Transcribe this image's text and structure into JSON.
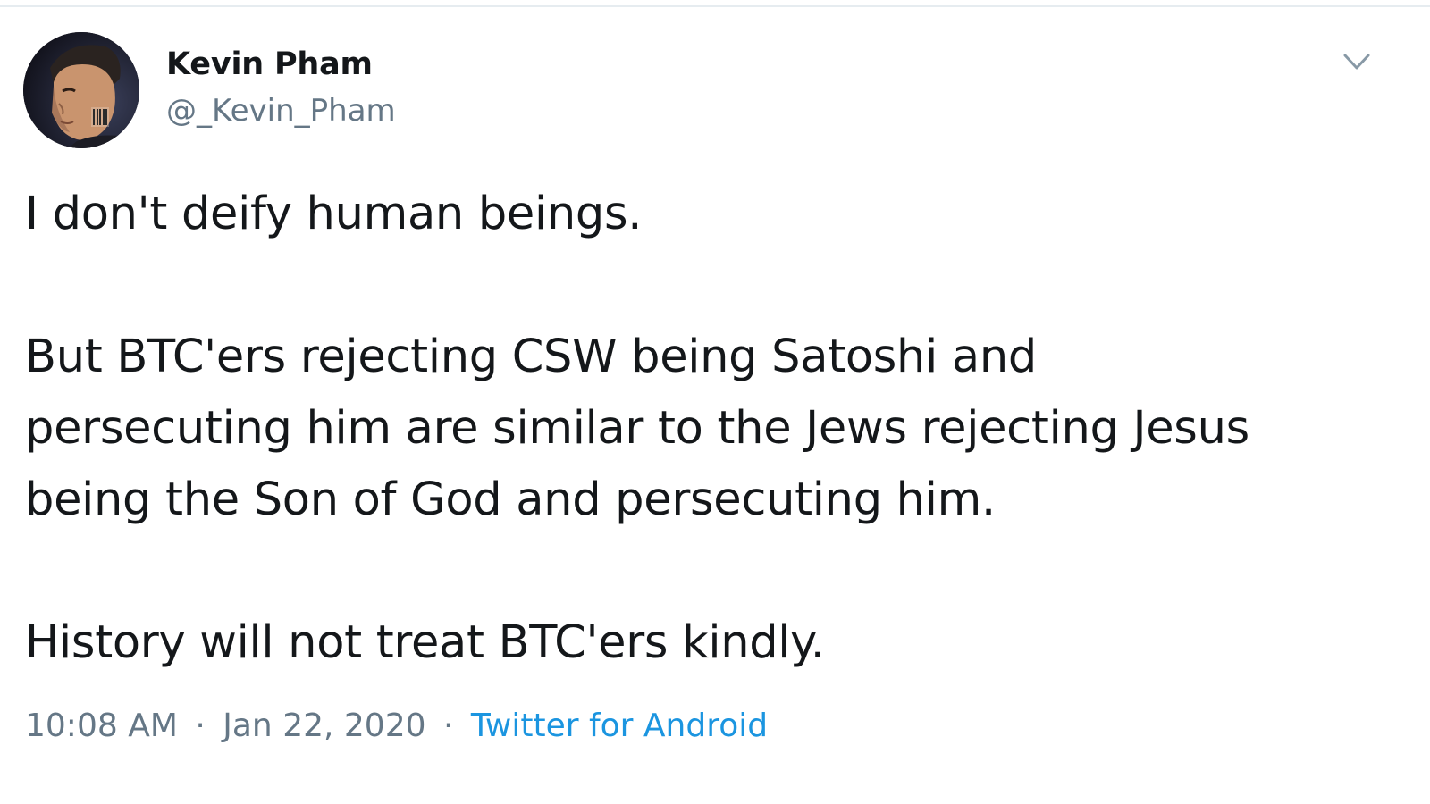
{
  "tweet": {
    "author": {
      "display_name": "Kevin Pham",
      "handle": "@_Kevin_Pham",
      "avatar_icon": "profile-photo"
    },
    "menu_icon": "chevron-down-icon",
    "body": {
      "p1": "I don't deify human beings.",
      "p2_line1": "But BTC'ers rejecting CSW being Satoshi and",
      "p2_line2": "persecuting him are similar to the Jews rejecting Jesus",
      "p2_line3": "being the Son of God and persecuting him.",
      "p3": "History will not treat BTC'ers kindly."
    },
    "meta": {
      "time": "10:08 AM",
      "separator": "·",
      "date": "Jan 22, 2020",
      "source": "Twitter for Android"
    }
  },
  "colors": {
    "text": "#14171a",
    "secondary": "#657786",
    "link": "#1b95e0",
    "divider": "#e6ecf0"
  }
}
